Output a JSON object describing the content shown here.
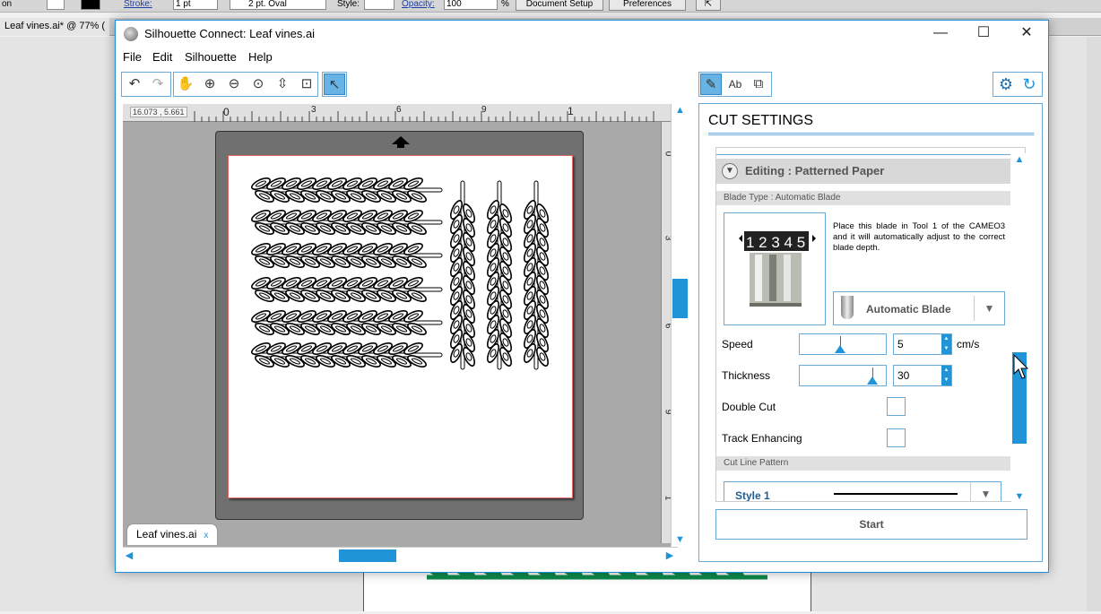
{
  "illustrator": {
    "toolbar": {
      "label_left": "on",
      "stroke_label": "Stroke:",
      "stroke_weight": "1 pt",
      "brush": "2 pt. Oval",
      "style_label": "Style:",
      "opacity_label": "Opacity:",
      "opacity_value": "100",
      "opacity_unit": "%",
      "document_setup": "Document Setup",
      "preferences": "Preferences"
    },
    "tab_title": "Leaf vines.ai* @ 77% ("
  },
  "window": {
    "title": "Silhouette Connect: Leaf vines.ai",
    "minimize": "—",
    "maximize": "☐",
    "close": "✕"
  },
  "menu": [
    "File",
    "Edit",
    "Silhouette",
    "Help"
  ],
  "toolbar": {
    "undo": "↶",
    "redo": "↷",
    "pan": "✋",
    "zoom_in": "⊕",
    "zoom_out": "⊖",
    "zoom_select": "⊙",
    "zoom_fit": "⇳",
    "fit_page": "⊡",
    "select": "↖"
  },
  "ruler": {
    "coordinates": "16.073 , 5.661",
    "top_numbers": [
      "0",
      "3",
      "6",
      "9",
      "1"
    ],
    "side_numbers": [
      "0",
      "3",
      "6",
      "9",
      "1"
    ]
  },
  "document_tab": {
    "name": "Leaf vines.ai",
    "close": "x"
  },
  "panel": {
    "title": "CUT SETTINGS",
    "editing_label": "Editing : Patterned Paper",
    "blade_type_label": "Blade Type : Automatic Blade",
    "blade_digits": "1 2 3 4 5",
    "blade_description": "Place this blade in Tool 1 of the CAMEO3 and it will automatically adjust to the correct blade depth.",
    "blade_select": "Automatic Blade",
    "speed_label": "Speed",
    "speed_value": "5",
    "speed_unit": "cm/s",
    "speed_level": 0.45,
    "thickness_label": "Thickness",
    "thickness_value": "30",
    "thickness_level": 0.87,
    "double_cut_label": "Double Cut",
    "track_enhancing_label": "Track Enhancing",
    "cut_line_pattern_label": "Cut Line Pattern",
    "style_select": "Style 1",
    "start_button": "Start"
  }
}
